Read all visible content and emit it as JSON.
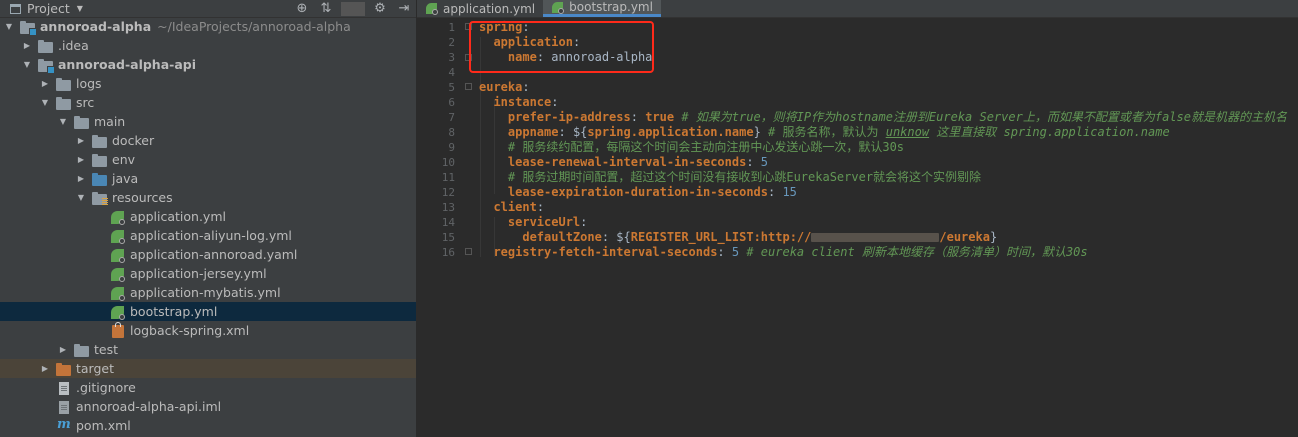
{
  "project_panel": {
    "title": "Project",
    "tools": {
      "target_icon": "crosshair-icon",
      "collapse_icon": "collapse-all-icon",
      "settings_icon": "gear-icon",
      "hide_icon": "hide-icon"
    },
    "tree": [
      {
        "label": "annoroad-alpha",
        "path": "~/IdeaProjects/annoroad-alpha",
        "bold": true
      },
      {
        "label": ".idea"
      },
      {
        "label": "annoroad-alpha-api",
        "bold": true
      },
      {
        "label": "logs"
      },
      {
        "label": "src"
      },
      {
        "label": "main"
      },
      {
        "label": "docker"
      },
      {
        "label": "env"
      },
      {
        "label": "java"
      },
      {
        "label": "resources"
      },
      {
        "label": "application.yml"
      },
      {
        "label": "application-aliyun-log.yml"
      },
      {
        "label": "application-annoroad.yaml"
      },
      {
        "label": "application-jersey.yml"
      },
      {
        "label": "application-mybatis.yml"
      },
      {
        "label": "bootstrap.yml"
      },
      {
        "label": "logback-spring.xml"
      },
      {
        "label": "test"
      },
      {
        "label": "target"
      },
      {
        "label": ".gitignore"
      },
      {
        "label": "annoroad-alpha-api.iml"
      },
      {
        "label": "pom.xml"
      }
    ]
  },
  "editor": {
    "tabs": [
      {
        "label": "application.yml",
        "active": false
      },
      {
        "label": "bootstrap.yml",
        "active": true
      }
    ],
    "line_numbers": [
      "1",
      "2",
      "3",
      "4",
      "5",
      "6",
      "7",
      "8",
      "9",
      "10",
      "11",
      "12",
      "13",
      "14",
      "15",
      "16"
    ],
    "code": {
      "l1_key": "spring",
      "l2_key": "application",
      "l3_key": "name",
      "l3_val": "annoroad-alpha",
      "l5_key": "eureka",
      "l6_key": "instance",
      "l7_key": "prefer-ip-address",
      "l7_val": "true",
      "l7_comment": "# 如果为true，则将IP作为hostname注册到Eureka Server上，而如果不配置或者为false就是机器的主机名",
      "l8_key": "appname",
      "l8_val_a": "${",
      "l8_val_b": "spring.application.name",
      "l8_val_c": "}",
      "l8_comment_a": "# 服务名称，默认为 ",
      "l8_comment_b": "unknow",
      "l8_comment_c": " 这里直接取 spring.application.name",
      "l9_comment": "# 服务续约配置，每隔这个时间会主动向注册中心发送心跳一次，默认30s",
      "l10_key": "lease-renewal-interval-in-seconds",
      "l10_val": "5",
      "l11_comment": "# 服务过期时间配置，超过这个时间没有接收到心跳EurekaServer就会将这个实例剔除",
      "l12_key": "lease-expiration-duration-in-seconds",
      "l12_val": "15",
      "l13_key": "client",
      "l14_key": "serviceUrl",
      "l15_key": "defaultZone",
      "l15_val_a": "${",
      "l15_val_b": "REGISTER_URL_LIST:http://",
      "l15_val_c": "/eureka",
      "l15_val_d": "}",
      "l16_key": "registry-fetch-interval-seconds",
      "l16_val": "5",
      "l16_comment": "# eureka client 刷新本地缓存（服务清单）时间，默认30s"
    },
    "highlight_color": "#ff2a1a"
  }
}
